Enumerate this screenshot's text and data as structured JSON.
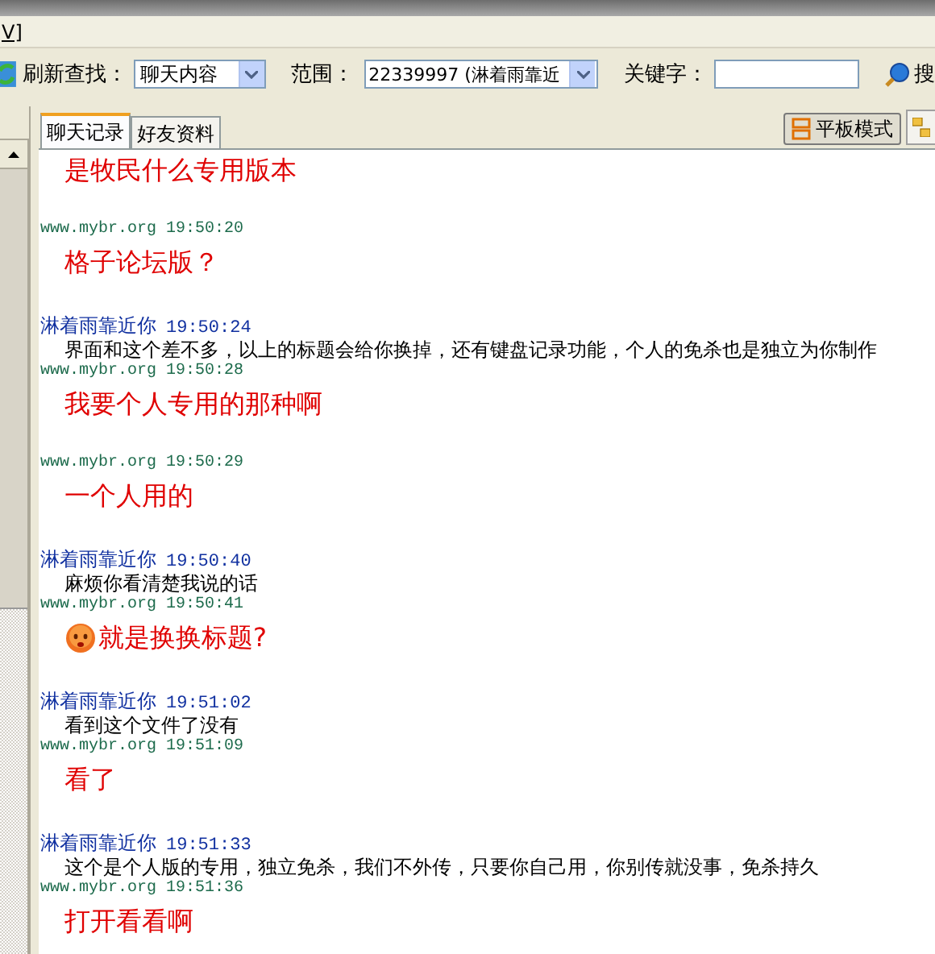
{
  "menu_bar": {
    "text": "V]"
  },
  "toolbar": {
    "refresh_label": "刷新查找：",
    "content_select": "聊天内容",
    "range_label": "范围：",
    "range_select": "22339997 (淋着雨靠近",
    "keyword_label": "关键字：",
    "search_button": "搜"
  },
  "tabs": [
    {
      "label": "聊天记录",
      "selected": true
    },
    {
      "label": "好友资料",
      "selected": false
    }
  ],
  "view_mode_button": {
    "label": "平板模式",
    "selected": true
  },
  "messages": [
    {
      "kind": "other",
      "text": "是牧民什么专用版本",
      "emoticon": false
    },
    {
      "kind": "other",
      "sender": "www.mybr.org",
      "time": "19:50:20",
      "text": "格子论坛版？",
      "emoticon": false
    },
    {
      "kind": "self",
      "sender": "淋着雨靠近你",
      "time": "19:50:24",
      "text": "界面和这个差不多，以上的标题会给你换掉，还有键盘记录功能，个人的免杀也是独立为你制作",
      "emoticon": false
    },
    {
      "kind": "other",
      "sender": "www.mybr.org",
      "time": "19:50:28",
      "text": "我要个人专用的那种啊",
      "emoticon": false
    },
    {
      "kind": "other",
      "sender": "www.mybr.org",
      "time": "19:50:29",
      "text": "一个人用的",
      "emoticon": false
    },
    {
      "kind": "self",
      "sender": "淋着雨靠近你",
      "time": "19:50:40",
      "text": "麻烦你看清楚我说的话",
      "emoticon": false
    },
    {
      "kind": "other",
      "sender": "www.mybr.org",
      "time": "19:50:41",
      "text": "就是换换标题?",
      "emoticon": true
    },
    {
      "kind": "self",
      "sender": "淋着雨靠近你",
      "time": "19:51:02",
      "text": "看到这个文件了没有",
      "emoticon": false
    },
    {
      "kind": "other",
      "sender": "www.mybr.org",
      "time": "19:51:09",
      "text": "看了",
      "emoticon": false
    },
    {
      "kind": "self",
      "sender": "淋着雨靠近你",
      "time": "19:51:33",
      "text": "这个是个人版的专用，独立免杀，我们不外传，只要你自己用，你别传就没事，免杀持久",
      "emoticon": false
    },
    {
      "kind": "other",
      "sender": "www.mybr.org",
      "time": "19:51:36",
      "text": "打开看看啊",
      "emoticon": false
    }
  ]
}
